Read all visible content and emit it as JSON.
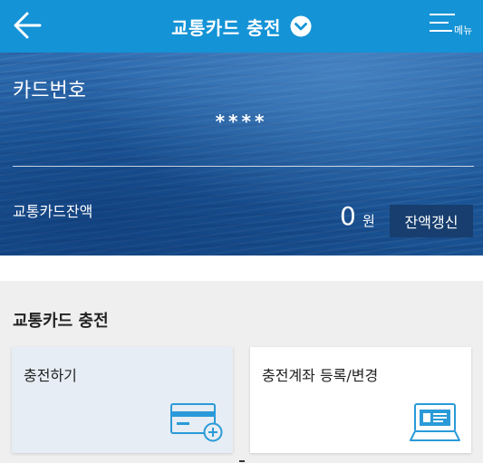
{
  "header": {
    "title": "교통카드 충전",
    "back_icon": "arrow-left-icon",
    "dropdown_icon": "chevron-down-circle-icon",
    "menu_icon": "hamburger-icon",
    "menu_label": "메뉴",
    "bg_color": "#1493d6"
  },
  "card": {
    "label": "카드번호",
    "number": "****",
    "balance_label": "교통카드잔액",
    "balance_value": "0",
    "balance_unit": "원",
    "refresh_label": "잔액갱신"
  },
  "section": {
    "title": "교통카드 충전",
    "tiles": [
      {
        "label": "충전하기",
        "icon": "card-add-icon"
      },
      {
        "label": "충전계좌 등록/변경",
        "icon": "laptop-icon"
      }
    ]
  },
  "colors": {
    "accent": "#1493d6",
    "icon_stroke": "#2a9ad8",
    "refresh_button": "#173e6e"
  }
}
